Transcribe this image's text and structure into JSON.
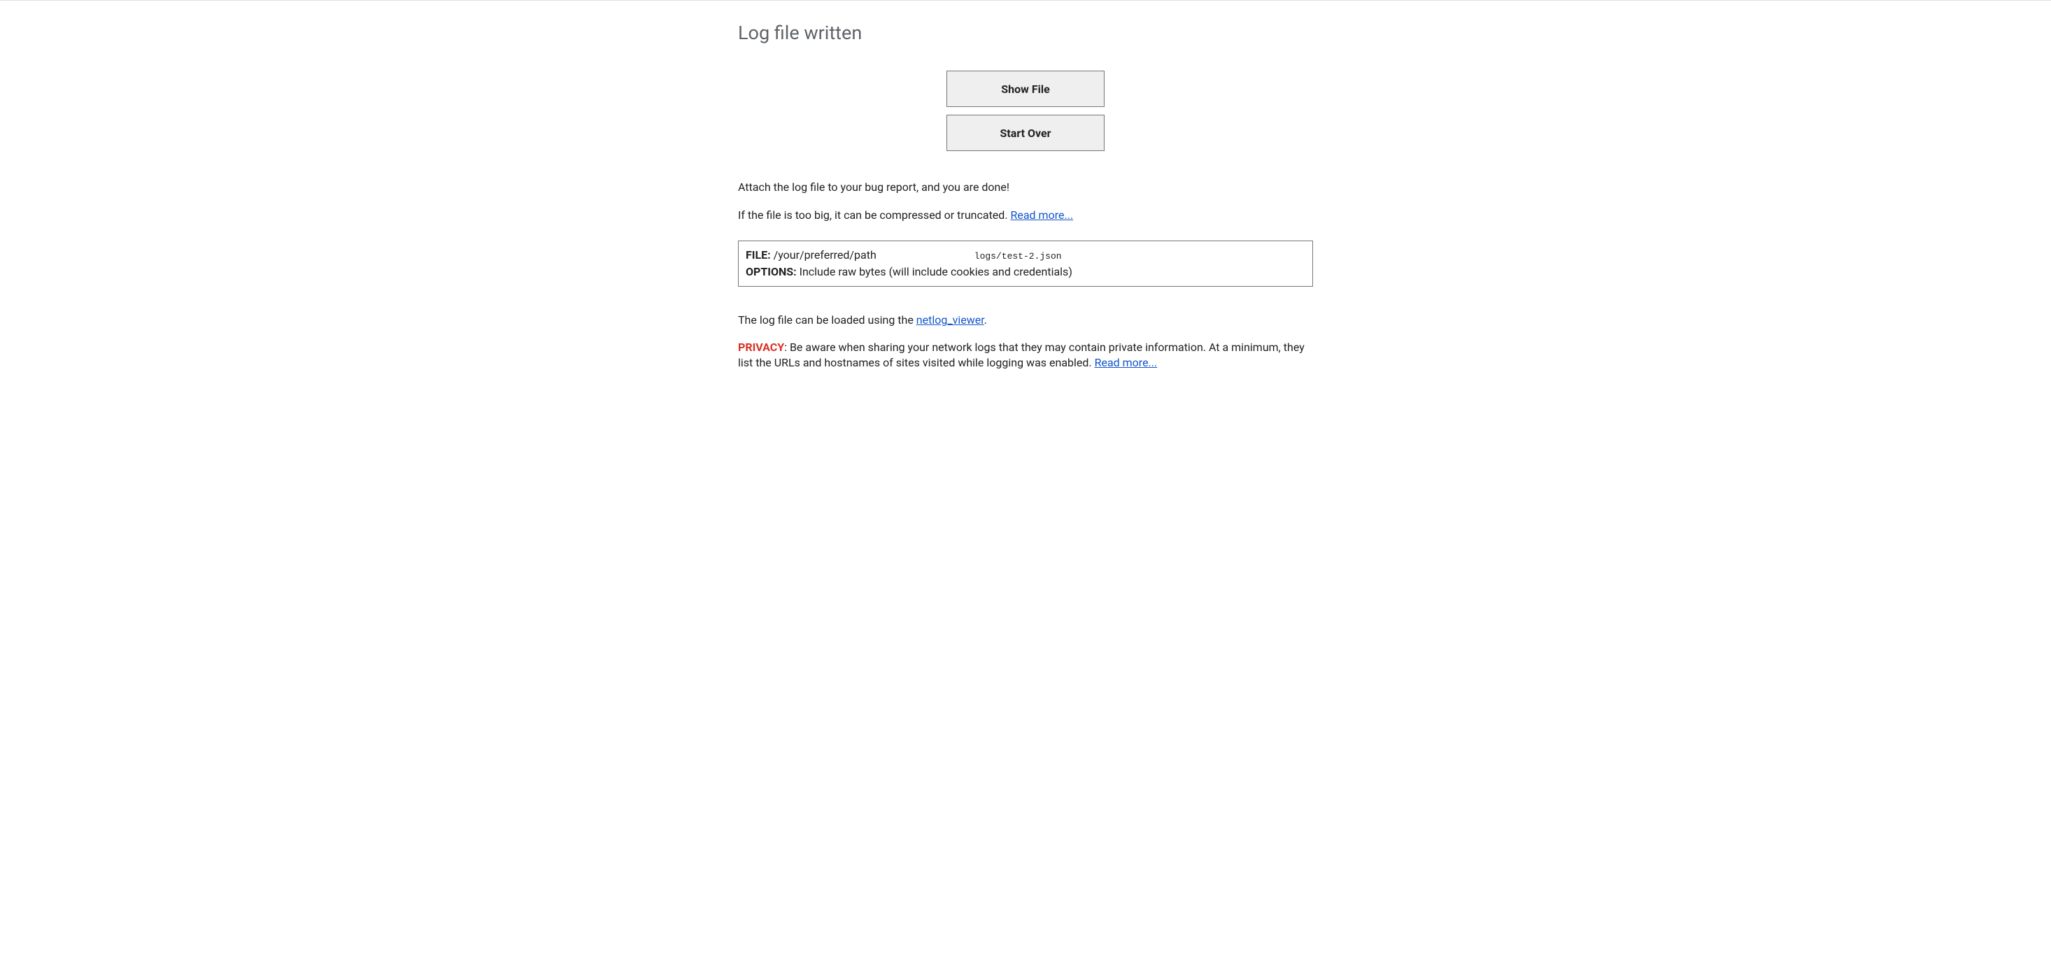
{
  "header": {
    "title": "Log file written"
  },
  "buttons": {
    "show_file": "Show File",
    "start_over": "Start Over"
  },
  "instructions": {
    "attach": "Attach the log file to your bug report, and you are done!",
    "big_file_prefix": "If the file is too big, it can be compressed or truncated. ",
    "read_more": "Read more..."
  },
  "info_box": {
    "file_label": "FILE:",
    "file_path_prefix": " /your/preferred/path",
    "file_path_suffix": "logs/test-2.json",
    "options_label": "OPTIONS:",
    "options_value": " Include raw bytes (will include cookies and credentials)"
  },
  "viewer": {
    "prefix": "The log file can be loaded using the ",
    "link": "netlog_viewer",
    "suffix": "."
  },
  "privacy": {
    "label": "PRIVACY",
    "text": ": Be aware when sharing your network logs that they may contain private information. At a minimum, they list the URLs and hostnames of sites visited while logging was enabled. ",
    "read_more": "Read more..."
  }
}
